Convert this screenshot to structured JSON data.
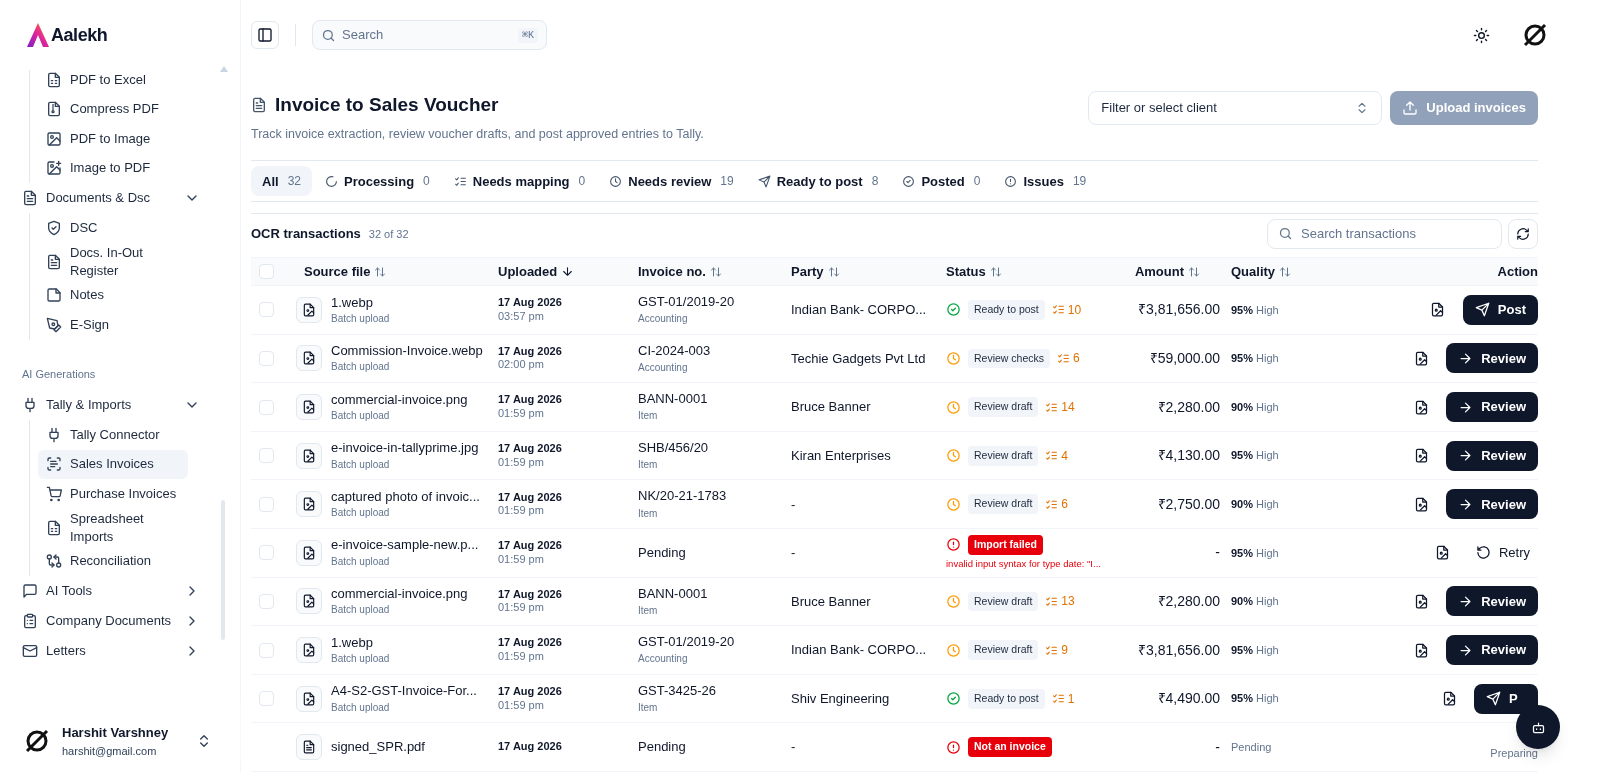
{
  "sidebar": {
    "logo": "Aalekh",
    "nav": [
      {
        "children": [
          {
            "label": "PDF to Excel",
            "selected": false
          },
          {
            "label": "Compress PDF",
            "selected": false
          },
          {
            "label": "PDF to Image",
            "selected": false
          },
          {
            "label": "Image to PDF",
            "selected": false
          }
        ]
      },
      {
        "label": "Documents & Dsc",
        "expanded": true,
        "children": [
          {
            "label": "DSC",
            "selected": false
          },
          {
            "label": "Docs. In-Out Register",
            "selected": false
          },
          {
            "label": "Notes",
            "selected": false
          },
          {
            "label": "E-Sign",
            "selected": false
          }
        ]
      },
      {
        "kind": "section",
        "label": "AI Generations"
      },
      {
        "label": "Tally & Imports",
        "expanded": true,
        "children": [
          {
            "label": "Tally Connector",
            "selected": false
          },
          {
            "label": "Sales Invoices",
            "selected": true
          },
          {
            "label": "Purchase Invoices",
            "selected": false
          },
          {
            "label": "Spreadsheet Imports",
            "selected": false
          },
          {
            "label": "Reconciliation",
            "selected": false
          }
        ]
      },
      {
        "label": "AI Tools",
        "expanded": false
      },
      {
        "label": "Company Documents",
        "expanded": false
      },
      {
        "label": "Letters",
        "expanded": false
      }
    ],
    "user": {
      "name": "Harshit Varshney",
      "email": "harshit@gmail.com"
    }
  },
  "topbar": {
    "search": {
      "placeholder": "Search",
      "shortcut": "⌘K"
    }
  },
  "page": {
    "title": "Invoice to Sales Voucher",
    "subtitle": "Track invoice extraction, review voucher drafts, and post approved entries to Tally.",
    "client_select": {
      "placeholder": "Filter or select client"
    },
    "upload_button": {
      "label": "Upload invoices",
      "disabled": true
    }
  },
  "tabs": [
    {
      "label": "All",
      "count": "32",
      "selected": true
    },
    {
      "label": "Processing",
      "count": "0",
      "selected": false
    },
    {
      "label": "Needs mapping",
      "count": "0",
      "selected": false
    },
    {
      "label": "Needs review",
      "count": "19",
      "selected": false
    },
    {
      "label": "Ready to post",
      "count": "8",
      "selected": false
    },
    {
      "label": "Posted",
      "count": "0",
      "selected": false
    },
    {
      "label": "Issues",
      "count": "19",
      "selected": false
    }
  ],
  "table": {
    "title": "OCR transactions",
    "count": "32 of 32",
    "search": {
      "placeholder": "Search transactions"
    },
    "all_checked": false,
    "columns": [
      {
        "label": "Source file",
        "sortable": true,
        "sorted": false
      },
      {
        "label": "Uploaded",
        "sortable": true,
        "sorted": true
      },
      {
        "label": "Invoice no.",
        "sortable": true,
        "sorted": false
      },
      {
        "label": "Party",
        "sortable": true,
        "sorted": false
      },
      {
        "label": "Status",
        "sortable": true,
        "sorted": false
      },
      {
        "label": "Amount",
        "sortable": true,
        "sorted": false
      },
      {
        "label": "Quality",
        "sortable": true,
        "sorted": false
      },
      {
        "label": "Action",
        "sortable": false,
        "sorted": false
      }
    ],
    "rows": [
      {
        "kind": "image",
        "checked": false,
        "file": "1.webp",
        "file_sub": "Batch upload",
        "date": "17 Aug 2026",
        "time": "03:57 pm",
        "invoice": "GST-01/2019-20",
        "invoice_sub": "Accounting",
        "party": "Indian Bank- CORPO...",
        "status": {
          "kind": "ok",
          "label": "Ready to post",
          "checks": "10"
        },
        "amount": "₹3,81,656.00",
        "quality": "95%",
        "quality_label": "High",
        "action": {
          "kind": "post",
          "label": "Post"
        }
      },
      {
        "kind": "image",
        "checked": false,
        "file": "Commission-Invoice.webp",
        "file_sub": "Batch upload",
        "date": "17 Aug 2026",
        "time": "02:00 pm",
        "invoice": "CI-2024-003",
        "invoice_sub": "Accounting",
        "party": "Techie Gadgets Pvt Ltd",
        "status": {
          "kind": "review",
          "label": "Review checks",
          "checks": "6"
        },
        "amount": "₹59,000.00",
        "quality": "95%",
        "quality_label": "High",
        "action": {
          "kind": "review",
          "label": "Review"
        }
      },
      {
        "kind": "image",
        "checked": false,
        "file": "commercial-invoice.png",
        "file_sub": "Batch upload",
        "date": "17 Aug 2026",
        "time": "01:59 pm",
        "invoice": "BANN-0001",
        "invoice_sub": "Item",
        "party": "Bruce Banner",
        "status": {
          "kind": "review",
          "label": "Review draft",
          "checks": "14"
        },
        "amount": "₹2,280.00",
        "quality": "90%",
        "quality_label": "High",
        "action": {
          "kind": "review",
          "label": "Review"
        }
      },
      {
        "kind": "image",
        "checked": false,
        "file": "e-invoice-in-tallyprime.jpg",
        "file_sub": "Batch upload",
        "date": "17 Aug 2026",
        "time": "01:59 pm",
        "invoice": "SHB/456/20",
        "invoice_sub": "Item",
        "party": "Kiran Enterprises",
        "status": {
          "kind": "review",
          "label": "Review draft",
          "checks": "4"
        },
        "amount": "₹4,130.00",
        "quality": "95%",
        "quality_label": "High",
        "action": {
          "kind": "review",
          "label": "Review"
        }
      },
      {
        "kind": "image",
        "checked": false,
        "file": "captured photo of invoic...",
        "file_sub": "Batch upload",
        "date": "17 Aug 2026",
        "time": "01:59 pm",
        "invoice": "NK/20-21-1783",
        "invoice_sub": "Item",
        "party": "-",
        "status": {
          "kind": "review",
          "label": "Review draft",
          "checks": "6"
        },
        "amount": "₹2,750.00",
        "quality": "90%",
        "quality_label": "High",
        "action": {
          "kind": "review",
          "label": "Review"
        }
      },
      {
        "kind": "image",
        "checked": false,
        "file": "e-invoice-sample-new.p...",
        "file_sub": "Batch upload",
        "date": "17 Aug 2026",
        "time": "01:59 pm",
        "invoice": "Pending",
        "party": "-",
        "status": {
          "kind": "error",
          "label": "Import failed",
          "error": "invalid input syntax for type date: \"I..."
        },
        "amount": "-",
        "quality": "95%",
        "quality_label": "High",
        "action": {
          "kind": "retry",
          "label": "Retry"
        }
      },
      {
        "kind": "image",
        "checked": false,
        "file": "commercial-invoice.png",
        "file_sub": "Batch upload",
        "date": "17 Aug 2026",
        "time": "01:59 pm",
        "invoice": "BANN-0001",
        "invoice_sub": "Item",
        "party": "Bruce Banner",
        "status": {
          "kind": "review",
          "label": "Review draft",
          "checks": "13"
        },
        "amount": "₹2,280.00",
        "quality": "90%",
        "quality_label": "High",
        "action": {
          "kind": "review",
          "label": "Review"
        }
      },
      {
        "kind": "image",
        "checked": false,
        "file": "1.webp",
        "file_sub": "Batch upload",
        "date": "17 Aug 2026",
        "time": "01:59 pm",
        "invoice": "GST-01/2019-20",
        "invoice_sub": "Accounting",
        "party": "Indian Bank- CORPO...",
        "status": {
          "kind": "review",
          "label": "Review draft",
          "checks": "9"
        },
        "amount": "₹3,81,656.00",
        "quality": "95%",
        "quality_label": "High",
        "action": {
          "kind": "review",
          "label": "Review"
        }
      },
      {
        "kind": "image",
        "checked": false,
        "file": "A4-S2-GST-Invoice-For...",
        "file_sub": "Batch upload",
        "date": "17 Aug 2026",
        "time": "01:59 pm",
        "invoice": "GST-3425-26",
        "invoice_sub": "Item",
        "party": "Shiv Engineering",
        "status": {
          "kind": "ok",
          "label": "Ready to post",
          "checks": "1"
        },
        "amount": "₹4,490.00",
        "quality": "95%",
        "quality_label": "High",
        "action": {
          "kind": "post",
          "label": "P"
        }
      },
      {
        "kind": "document",
        "file": "signed_SPR.pdf",
        "date": "17 Aug 2026",
        "invoice": "Pending",
        "party": "-",
        "status": {
          "kind": "error",
          "label": "Not an invoice"
        },
        "amount": "-",
        "quality_label": "Pending",
        "action": {
          "kind": "preparing",
          "label": "Preparing"
        }
      }
    ]
  }
}
